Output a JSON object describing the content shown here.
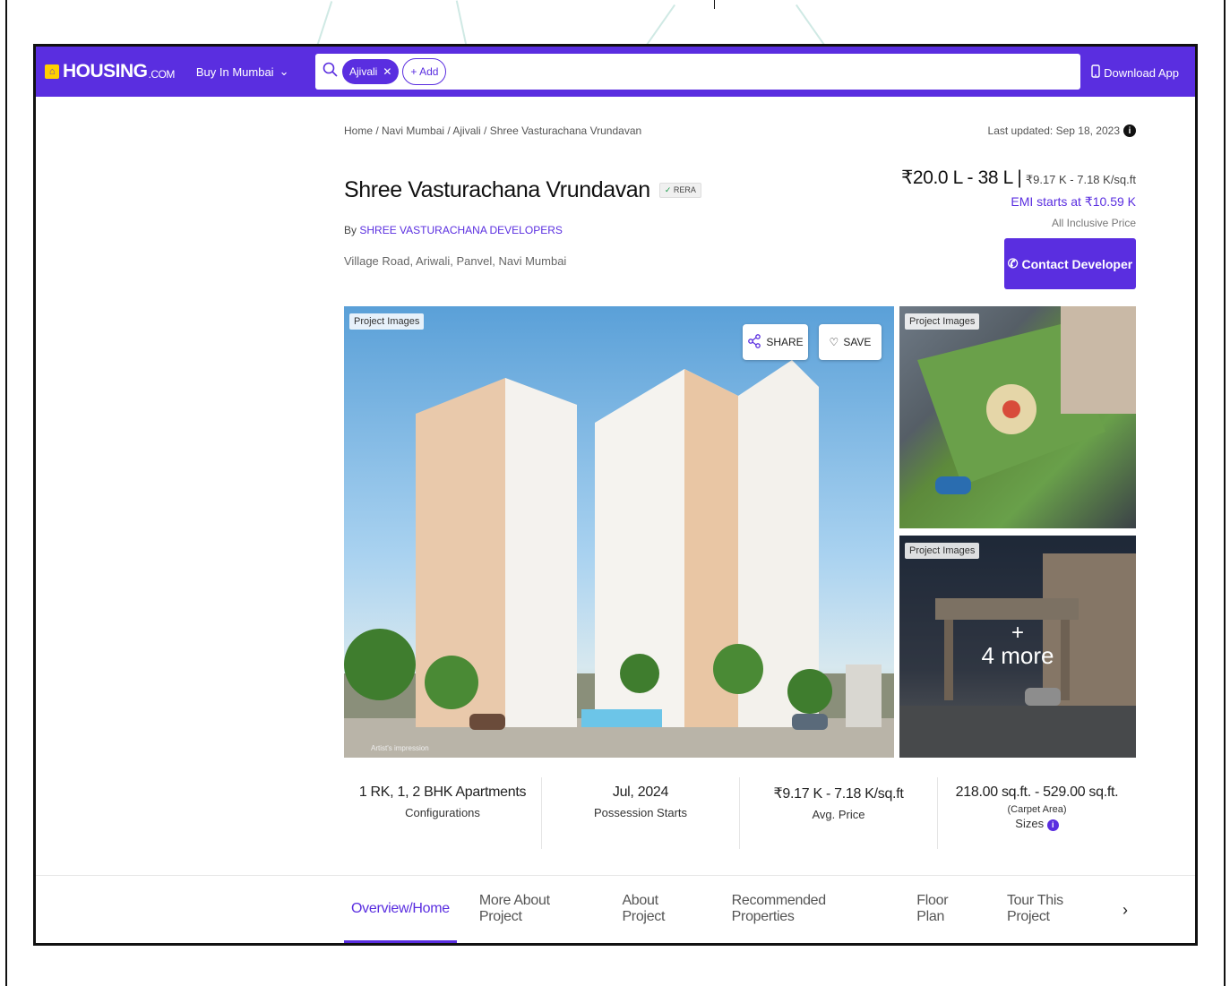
{
  "header": {
    "logo": "HOUSING",
    "logo_suffix": ".COM",
    "city_selector": "Buy In Mumbai",
    "search_chip": "Ajivali",
    "add_chip": "+ Add",
    "download_app": "Download App"
  },
  "breadcrumb": "Home / Navi Mumbai / Ajivali / Shree Vasturachana Vrundavan",
  "last_updated": "Last updated: Sep 18, 2023",
  "project": {
    "title": "Shree Vasturachana Vrundavan",
    "rera": "RERA",
    "by_prefix": "By",
    "developer": "SHREE VASTURACHANA DEVELOPERS",
    "address": "Village Road, Ariwali, Panvel, Navi Mumbai"
  },
  "pricing": {
    "range": "₹20.0 L - 38 L",
    "separator": "|",
    "per_sqft": "₹9.17 K - 7.18 K/sq.ft",
    "emi": "EMI starts at ₹10.59 K",
    "inclusive": "All Inclusive Price",
    "contact_button": "Contact Developer"
  },
  "images": {
    "label": "Project Images",
    "share": "SHARE",
    "save": "SAVE",
    "artist_note": "Artist's impression",
    "more_plus": "+",
    "more": "4 more"
  },
  "stats": [
    {
      "value": "1 RK, 1, 2 BHK Apartments",
      "label": "Configurations"
    },
    {
      "value": "Jul, 2024",
      "label": "Possession Starts"
    },
    {
      "value": "₹9.17 K - 7.18 K/sq.ft",
      "label": "Avg. Price"
    },
    {
      "value": "218.00 sq.ft. - 529.00 sq.ft.",
      "sub": "(Carpet Area)",
      "label": "Sizes"
    }
  ],
  "tabs": [
    "Overview/Home",
    "More About Project",
    "About Project",
    "Recommended Properties",
    "Floor Plan",
    "Tour This Project"
  ],
  "colors": {
    "brand": "#5a2ee0",
    "logo_yellow": "#ffd000"
  }
}
